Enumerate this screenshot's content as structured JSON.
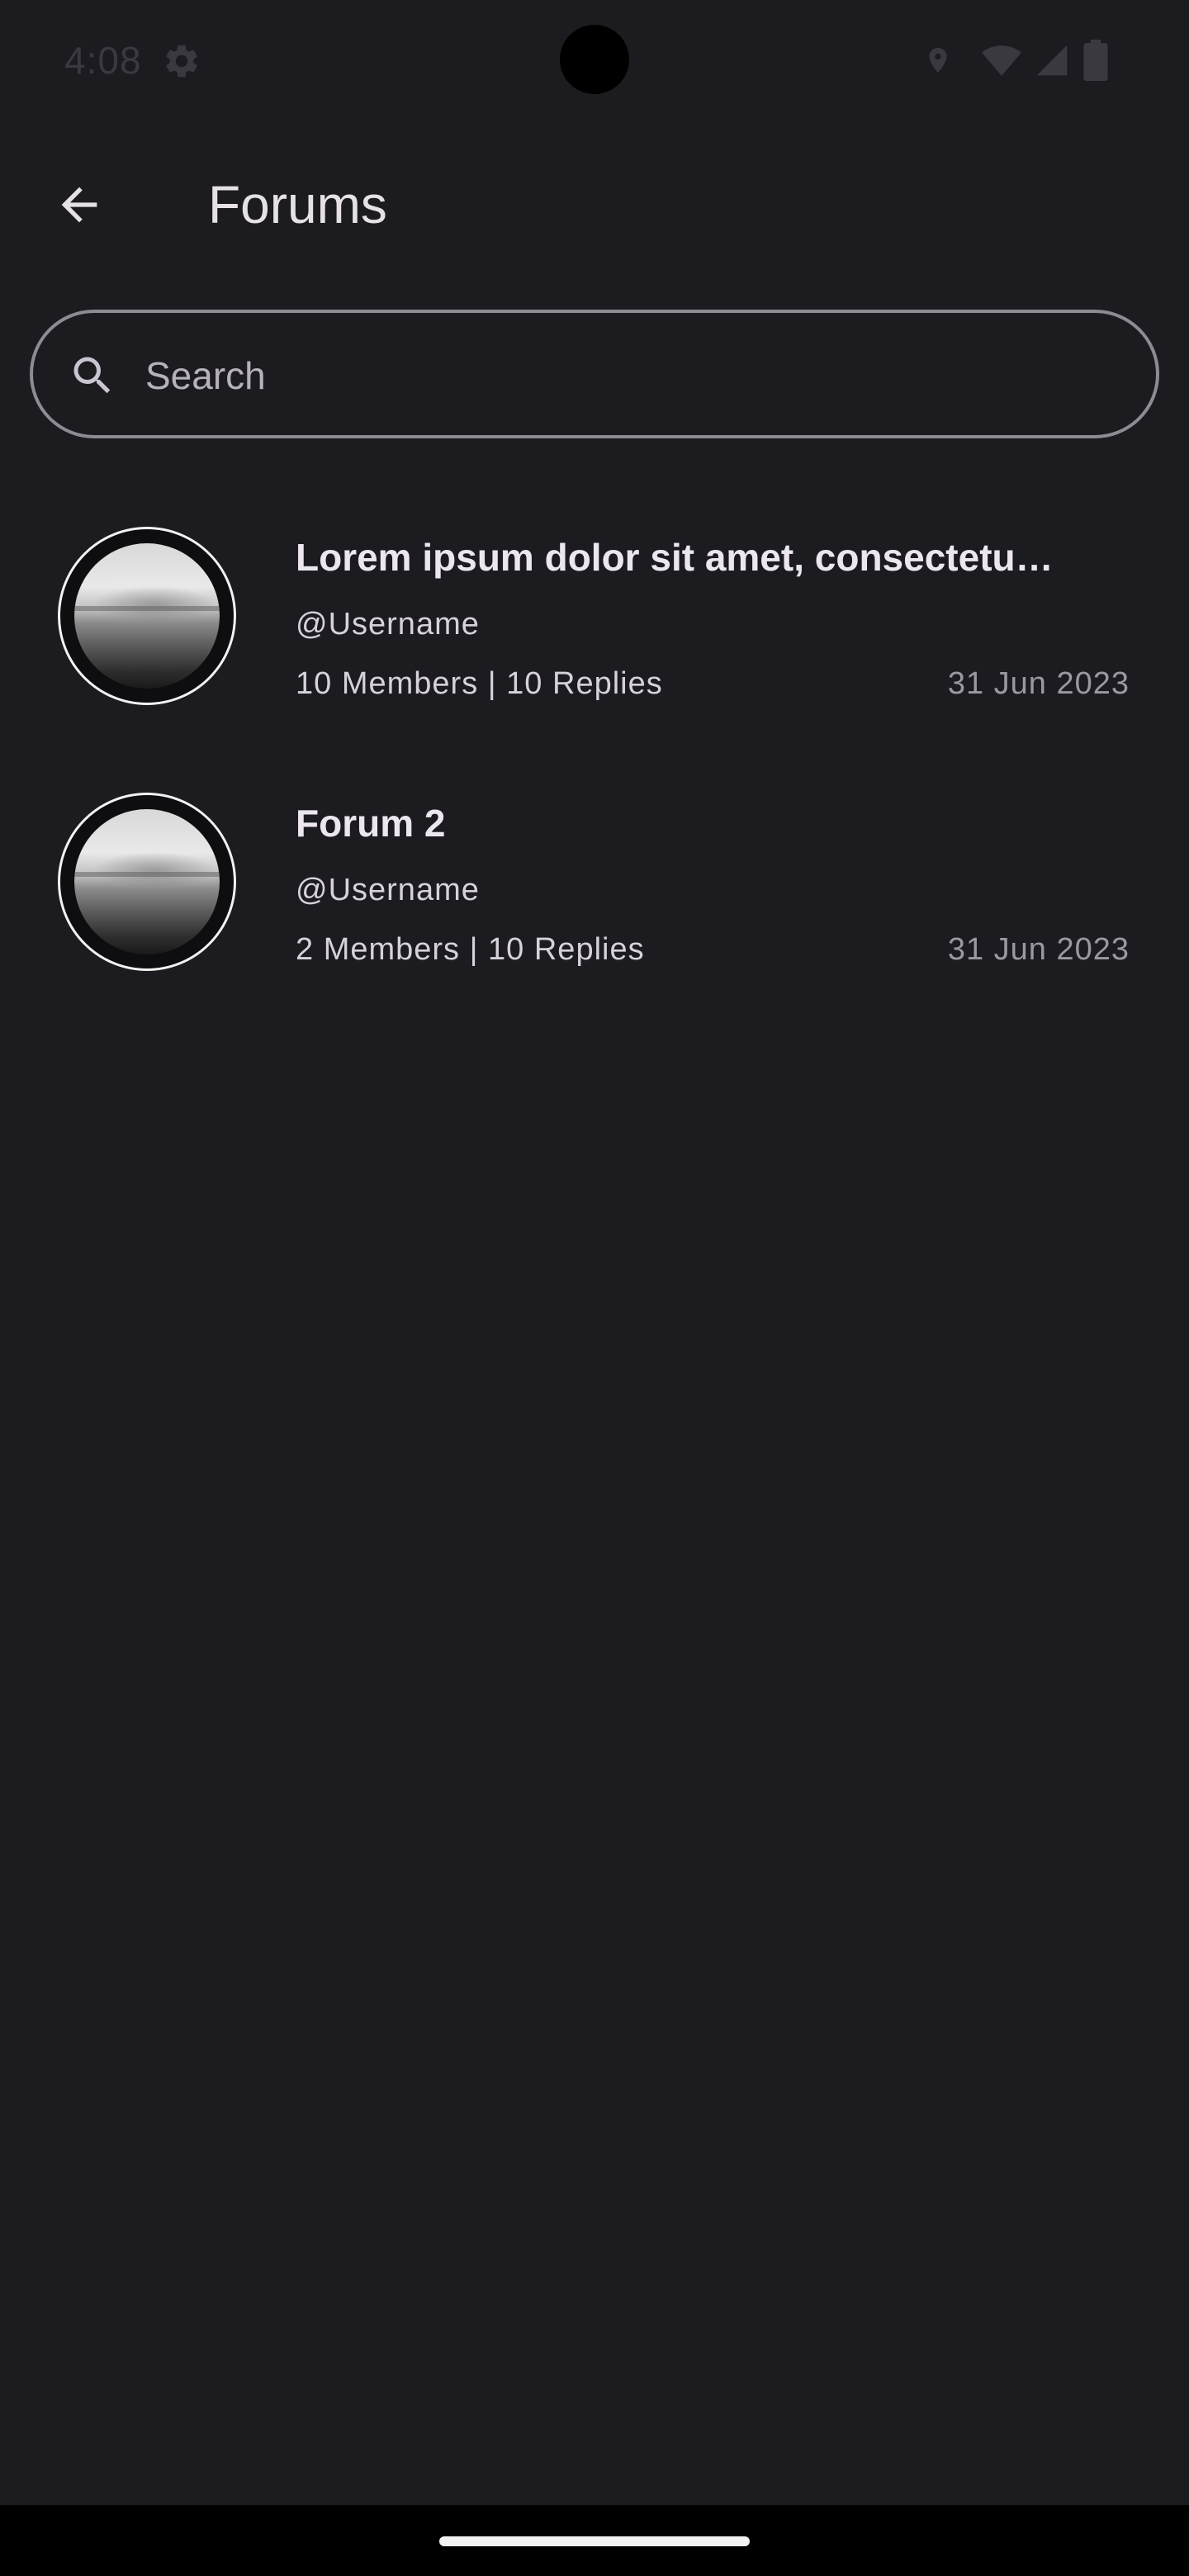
{
  "status_bar": {
    "time": "4:08",
    "icons": [
      "settings-icon",
      "location-icon",
      "wifi-icon",
      "cellular-icon",
      "battery-icon"
    ]
  },
  "app_bar": {
    "title": "Forums",
    "back_icon": "arrow-back-icon"
  },
  "search": {
    "placeholder": "Search",
    "value": "",
    "icon": "search-icon"
  },
  "forums": [
    {
      "title": "Lorem ipsum dolor sit amet, consectetu…",
      "username": "@Username",
      "stats": "10 Members | 10 Replies",
      "date": "31 Jun 2023",
      "avatar": "seascape-photo"
    },
    {
      "title": "Forum 2",
      "username": "@Username",
      "stats": "2 Members | 10 Replies",
      "date": "31 Jun 2023",
      "avatar": "seascape-photo"
    }
  ],
  "colors": {
    "background": "#1c1b20",
    "text_primary": "#e6e1e5",
    "text_secondary": "#d6d1da",
    "text_muted": "#9c98a1",
    "outline": "#8e8c93",
    "nav_bar": "#000000"
  }
}
